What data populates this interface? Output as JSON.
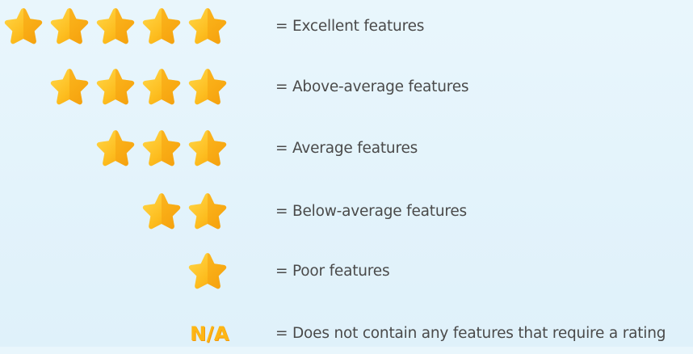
{
  "legend": {
    "rows": [
      {
        "stars": 5,
        "label": "= Excellent features"
      },
      {
        "stars": 4,
        "label": "= Above-average features"
      },
      {
        "stars": 3,
        "label": "= Average features"
      },
      {
        "stars": 2,
        "label": "= Below-average features"
      },
      {
        "stars": 1,
        "label": "= Poor features"
      }
    ],
    "na": {
      "badge": "N/A",
      "label": "= Does not contain any features that require a rating"
    }
  },
  "colors": {
    "star_light": "#ffd13b",
    "star_dark": "#f6a10f",
    "na_badge": "#fdb614",
    "label_text": "#4a4a4a",
    "background": "#e6f5fc"
  },
  "icons": {
    "rating": "star-icon"
  }
}
